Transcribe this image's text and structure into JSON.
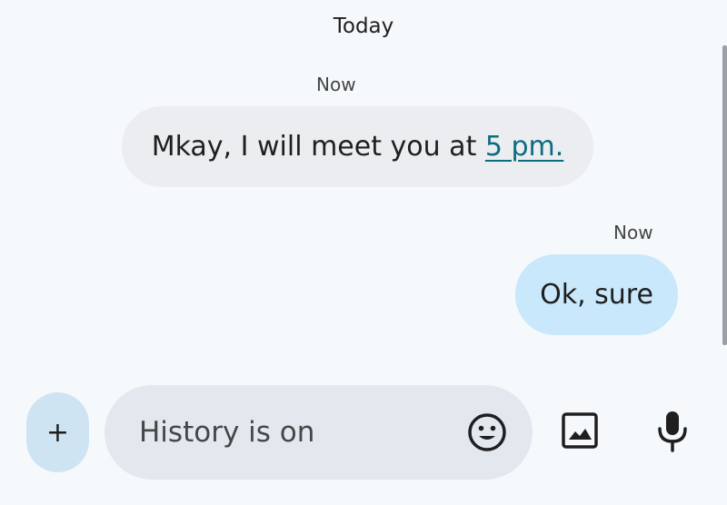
{
  "conversation": {
    "date_header": "Today",
    "messages": [
      {
        "direction": "incoming",
        "timestamp": "Now",
        "text_before_link": "Mkay, I will meet you at ",
        "link_text": "5 pm."
      },
      {
        "direction": "outgoing",
        "timestamp": "Now",
        "text": "Ok, sure"
      }
    ]
  },
  "composer": {
    "attach_label": "+",
    "placeholder": "History is on",
    "value": "",
    "icons": {
      "attach": "plus-icon",
      "emoji": "emoji-icon",
      "gallery": "image-icon",
      "voice": "mic-icon"
    }
  },
  "colors": {
    "background": "#f6f9fc",
    "incoming_bubble": "#ecedf0",
    "outgoing_bubble": "#c9e8fb",
    "link": "#0b6d80",
    "composer": "#e3e8ef",
    "attach_button": "#cfe4f3"
  }
}
